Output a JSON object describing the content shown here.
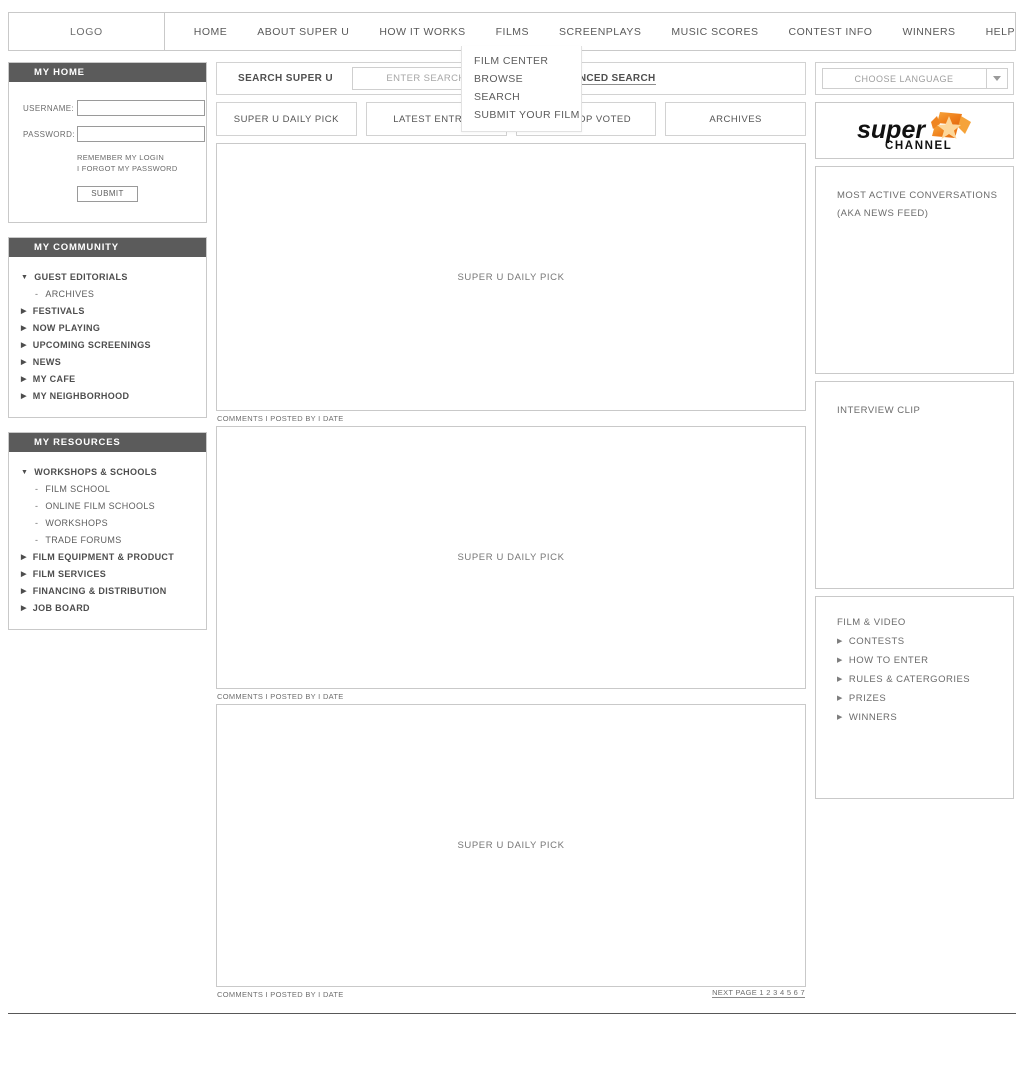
{
  "header": {
    "logo": "LOGO",
    "nav": [
      {
        "label": "HOME"
      },
      {
        "label": "ABOUT SUPER U"
      },
      {
        "label": "HOW IT WORKS"
      },
      {
        "label": "FILMS"
      },
      {
        "label": "SCREENPLAYS"
      },
      {
        "label": "MUSIC SCORES"
      },
      {
        "label": "CONTEST INFO"
      },
      {
        "label": "WINNERS"
      },
      {
        "label": "HELP"
      }
    ]
  },
  "films_dropdown": {
    "items": [
      {
        "label": "FILM CENTER"
      },
      {
        "label": "BROWSE"
      },
      {
        "label": "SEARCH"
      },
      {
        "label": "SUBMIT YOUR FILM"
      }
    ]
  },
  "sidebar_left": {
    "my_home": {
      "title": "MY HOME",
      "username_label": "USERNAME:",
      "username_value": "",
      "password_label": "PASSWORD:",
      "password_value": "",
      "remember_link": "REMEMBER MY LOGIN",
      "forgot_link": "I FORGOT MY PASSWORD",
      "submit_label": "SUBMIT"
    },
    "my_community": {
      "title": "MY COMMUNITY",
      "items": [
        {
          "label": "GUEST EDITORIALS",
          "expanded": true
        },
        {
          "label": "ARCHIVES",
          "child": true
        },
        {
          "label": "FESTIVALS",
          "expanded": false
        },
        {
          "label": "NOW PLAYING",
          "expanded": false
        },
        {
          "label": "UPCOMING SCREENINGS",
          "expanded": false
        },
        {
          "label": "NEWS",
          "expanded": false
        },
        {
          "label": "MY CAFE",
          "expanded": false
        },
        {
          "label": "MY NEIGHBORHOOD",
          "expanded": false
        }
      ]
    },
    "my_resources": {
      "title": "MY RESOURCES",
      "items": [
        {
          "label": "WORKSHOPS & SCHOOLS",
          "expanded": true
        },
        {
          "label": "FILM SCHOOL",
          "child": true
        },
        {
          "label": "ONLINE FILM SCHOOLS",
          "child": true
        },
        {
          "label": "WORKSHOPS",
          "child": true
        },
        {
          "label": "TRADE FORUMS",
          "child": true
        },
        {
          "label": "FILM EQUIPMENT & PRODUCT",
          "expanded": false
        },
        {
          "label": "FILM SERVICES",
          "expanded": false
        },
        {
          "label": "FINANCING & DISTRIBUTION",
          "expanded": false
        },
        {
          "label": "JOB BOARD",
          "expanded": false
        }
      ]
    }
  },
  "main": {
    "search": {
      "label": "SEARCH SUPER U",
      "placeholder": "ENTER SEARCH HERE",
      "value": "",
      "advanced_label": "ADVANCED SEARCH"
    },
    "tabs": [
      {
        "label": "SUPER U DAILY PICK"
      },
      {
        "label": "LATEST ENTRIES"
      },
      {
        "label": "USER TOP VOTED"
      },
      {
        "label": "ARCHIVES"
      }
    ],
    "media_items": [
      {
        "placeholder": "SUPER U DAILY PICK",
        "caption": "COMMENTS I POSTED BY I DATE"
      },
      {
        "placeholder": "SUPER U DAILY PICK",
        "caption": "COMMENTS I POSTED BY I DATE"
      },
      {
        "placeholder": "SUPER U DAILY PICK",
        "caption": "COMMENTS I POSTED BY I DATE"
      }
    ],
    "pager": "NEXT PAGE 1 2 3 4 5 6 7"
  },
  "sidebar_right": {
    "language": {
      "selected": "CHOOSE LANGUAGE",
      "arrow_icon": "chevron-down-icon"
    },
    "brand": {
      "word_mark": "super",
      "sub_mark": "CHANNEL",
      "accent_color": "#f07d1a"
    },
    "news_feed": {
      "line1": "MOST ACTIVE CONVERSATIONS",
      "line2": "(AKA NEWS FEED)"
    },
    "interview": {
      "title": "INTERVIEW CLIP"
    },
    "film_video": {
      "title": "FILM & VIDEO",
      "links": [
        {
          "label": "CONTESTS"
        },
        {
          "label": "HOW TO ENTER"
        },
        {
          "label": "RULES & CATERGORIES"
        },
        {
          "label": "PRIZES"
        },
        {
          "label": "WINNERS"
        }
      ]
    }
  }
}
